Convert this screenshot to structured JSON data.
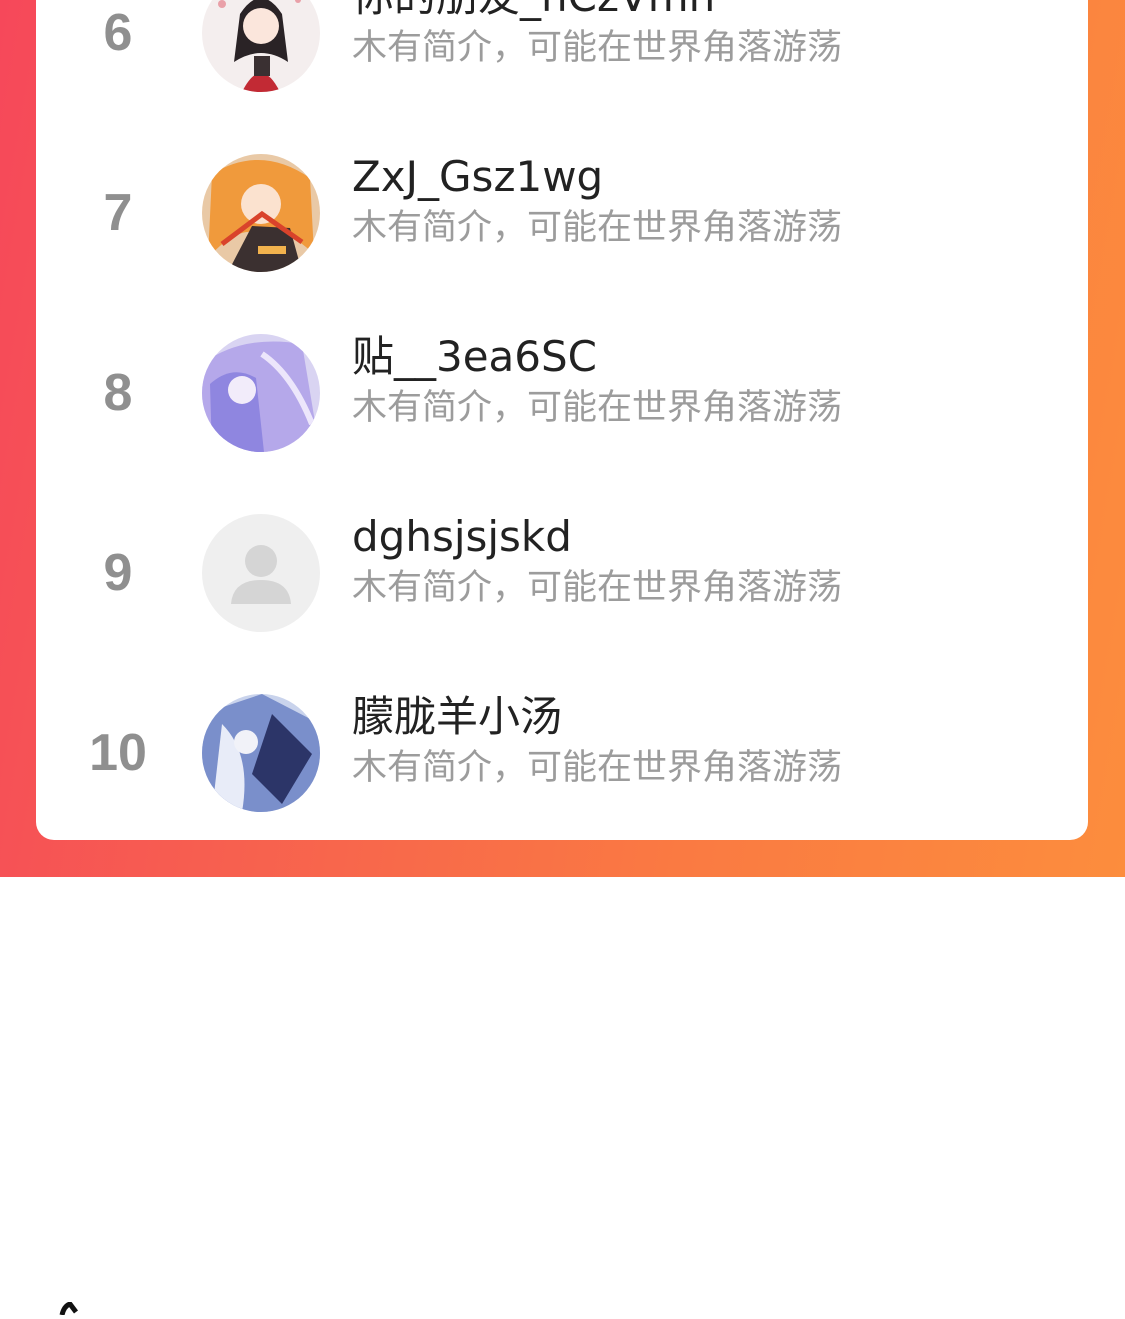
{
  "leaderboard": {
    "rows": [
      {
        "rank": "6",
        "name": "你的朋友_hCzVmn",
        "bio": "木有简介，可能在世界角落游荡",
        "avatar_icon": "anime-girl-avatar-icon"
      },
      {
        "rank": "7",
        "name": "ZxJ_Gsz1wg",
        "bio": "木有简介，可能在世界角落游荡",
        "avatar_icon": "anime-girl-orange-hair-avatar-icon"
      },
      {
        "rank": "8",
        "name": "贴__3ea6SC",
        "bio": "木有简介，可能在世界角落游荡",
        "avatar_icon": "anime-purple-hair-avatar-icon"
      },
      {
        "rank": "9",
        "name": "dghsjsjskd",
        "bio": "木有简介，可能在世界角落游荡",
        "avatar_icon": "default-user-avatar-icon"
      },
      {
        "rank": "10",
        "name": "朦胧羊小汤",
        "bio": "木有简介，可能在世界角落游荡",
        "avatar_icon": "anime-blue-avatar-icon"
      }
    ]
  },
  "colors": {
    "gradient_start": "#f6485a",
    "gradient_end": "#fc8d3d",
    "rank_text": "#8f8f8f",
    "name_text": "#222222",
    "bio_text": "#9c9c9c"
  }
}
